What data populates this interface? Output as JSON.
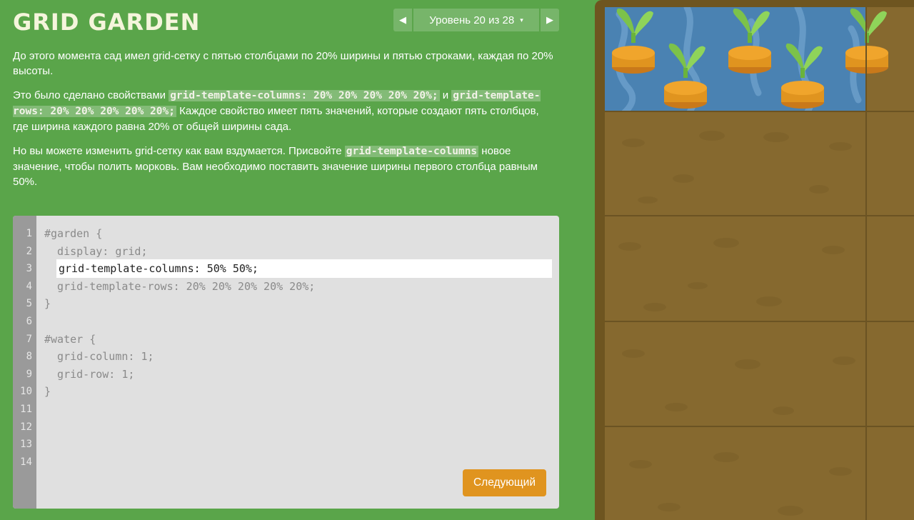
{
  "logo": {
    "text": "GRID GARDEN"
  },
  "level_nav": {
    "prev_icon": "triangle-left-icon",
    "label": "Уровень 20 из 28",
    "caret": "▾",
    "next_icon": "triangle-right-icon"
  },
  "description": {
    "p1": "До этого момента сад имел grid-сетку с пятью столбцами по 20% ширины и пятью строками, каждая по 20% высоты.",
    "p2_a": "Это было сделано свойствами ",
    "p2_code1": "grid-template-columns: 20% 20% 20% 20% 20%;",
    "p2_b": " и ",
    "p2_code2": "grid-template-rows: 20% 20% 20% 20% 20%;",
    "p2_c": " Каждое свойство имеет пять значений, которые создают пять столбцов, где ширина каждого равна 20% от общей ширины сада.",
    "p3_a": "Но вы можете изменить grid-сетку как вам вздумается. Присвойте ",
    "p3_code": "grid-template-columns",
    "p3_b": " новое значение, чтобы полить морковь. Вам необходимо поставить значение ширины первого столбца равным 50%."
  },
  "editor": {
    "line_numbers": "1\n2\n3\n4\n5\n6\n7\n8\n9\n10\n11\n12\n13\n14",
    "code_before": "#garden {\n  display: grid;",
    "input_value": "grid-template-columns: 50% 50%;",
    "code_after": "  grid-template-rows: 20% 20% 20% 20% 20%;\n}\n\n#water {\n  grid-column: 1;\n  grid-row: 1;\n}",
    "next_button": "Следующий"
  },
  "colors": {
    "background": "#5aa54a",
    "button_accent": "#e0941f",
    "water": "#4a82b2",
    "soil": "#86692f"
  }
}
